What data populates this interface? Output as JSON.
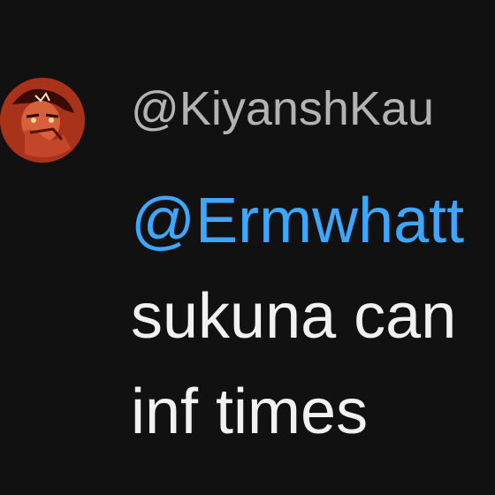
{
  "comment": {
    "avatar_icon": "profile-avatar-icon",
    "username": "@KiyanshKau",
    "mention": "@Ermwhatt",
    "text_lines": [
      "sukuna can",
      "inf times"
    ],
    "colors": {
      "background": "#111111",
      "username": "#b3b3b3",
      "mention": "#3ea6ff",
      "text": "#f1f1f1"
    }
  }
}
